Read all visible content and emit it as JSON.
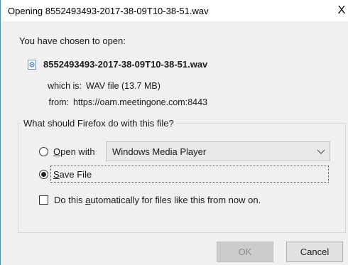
{
  "window": {
    "title": "Opening 8552493493-2017-38-09T10-38-51.wav",
    "close_glyph": "X"
  },
  "prompt": "You have chosen to open:",
  "file": {
    "icon": "audio-file-icon",
    "name": "8552493493-2017-38-09T10-38-51.wav",
    "type_label": "which is:",
    "type_value": "WAV file (13.7 MB)",
    "from_label": "from:",
    "from_value": "https://oam.meetingone.com:8443"
  },
  "action_group": {
    "legend": "What should Firefox do with this file?",
    "open_with": {
      "label_prefix": "O",
      "label_rest": "pen with",
      "selected": false,
      "app": "Windows Media Player"
    },
    "save_file": {
      "label_prefix": "S",
      "label_rest": "ave File",
      "selected": true
    },
    "auto_checkbox": {
      "label_before": "Do this ",
      "label_underlined": "a",
      "label_after": "utomatically for files like this from now on.",
      "checked": false
    }
  },
  "buttons": {
    "ok": "OK",
    "cancel": "Cancel",
    "ok_enabled": false
  },
  "colors": {
    "accent": "#4a8ad6",
    "dialog_bg": "#f0f0f0"
  }
}
